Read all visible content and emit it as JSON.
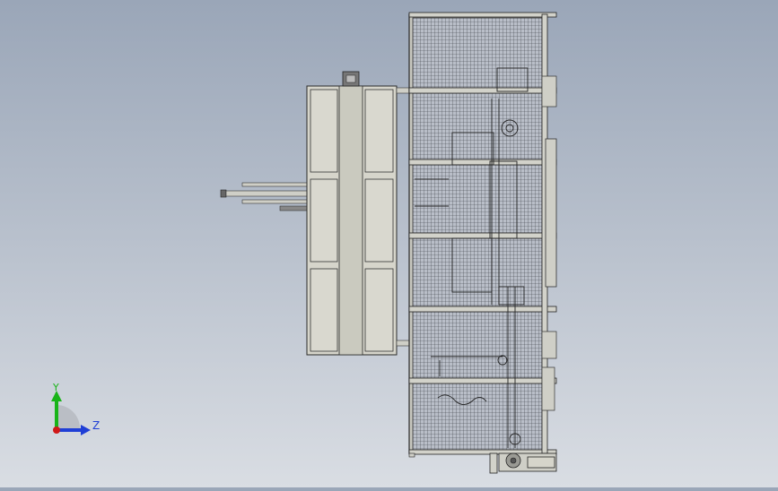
{
  "viewport": {
    "background_top": "#9aa6b8",
    "background_bottom": "#d9dde3",
    "part_fill": "#d6d5cb",
    "frame_stroke": "#2a2a2a",
    "mesh_fill": "#b8bcc6"
  },
  "triad": {
    "y_label": "Y",
    "z_label": "Z",
    "y_axis_color": "#19b419",
    "z_axis_color": "#1f3fd6",
    "origin_color": "#d01818"
  }
}
